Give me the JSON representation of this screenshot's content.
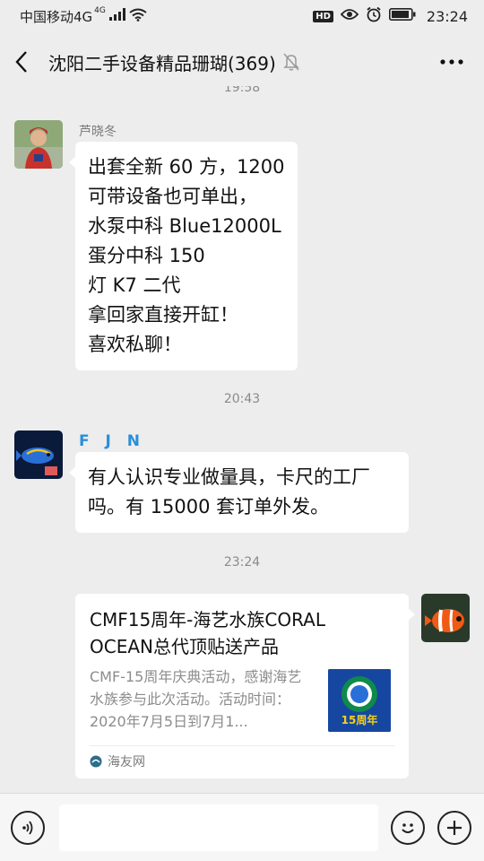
{
  "status_bar": {
    "carrier": "中国移动4G",
    "network_badge": "4G",
    "hd_badge": "HD",
    "time": "23:24"
  },
  "header": {
    "title": "沈阳二手设备精品珊瑚(369)"
  },
  "messages": [
    {
      "type": "time",
      "text": "19:58"
    },
    {
      "type": "text",
      "sender": "芦晓冬",
      "lines": "出套全新 60 方，1200\n可带设备也可单出，\n水泵中科 Blue12000L\n蛋分中科 150\n灯 K7 二代\n拿回家直接开缸！\n喜欢私聊！"
    },
    {
      "type": "time",
      "text": "20:43"
    },
    {
      "type": "text",
      "sender": "F J N",
      "lines": "有人认识专业做量具，卡尺的工厂\n吗。有 15000 套订单外发。"
    },
    {
      "type": "time",
      "text": "23:24"
    },
    {
      "type": "link_card",
      "title": "CMF15周年-海艺水族CORAL OCEAN总代顶贴送产品",
      "description": "CMF-15周年庆典活动，感谢海艺水族参与此次活动。活动时间：2020年7月5日到7月1...",
      "thumb_text": "15周年",
      "source": "海友网"
    }
  ],
  "input_bar": {
    "placeholder": ""
  },
  "colors": {
    "background": "#ededed",
    "bubble": "#ffffff",
    "name_fjn": "#2a8fd8",
    "time_text": "#8a8a8a"
  },
  "icons": [
    "signal-icon",
    "wifi-icon",
    "eye-icon",
    "alarm-icon",
    "battery-icon",
    "back-arrow-icon",
    "mute-bell-icon",
    "more-dots-icon",
    "voice-icon",
    "emoji-icon",
    "plus-icon",
    "hy-logo-icon"
  ]
}
